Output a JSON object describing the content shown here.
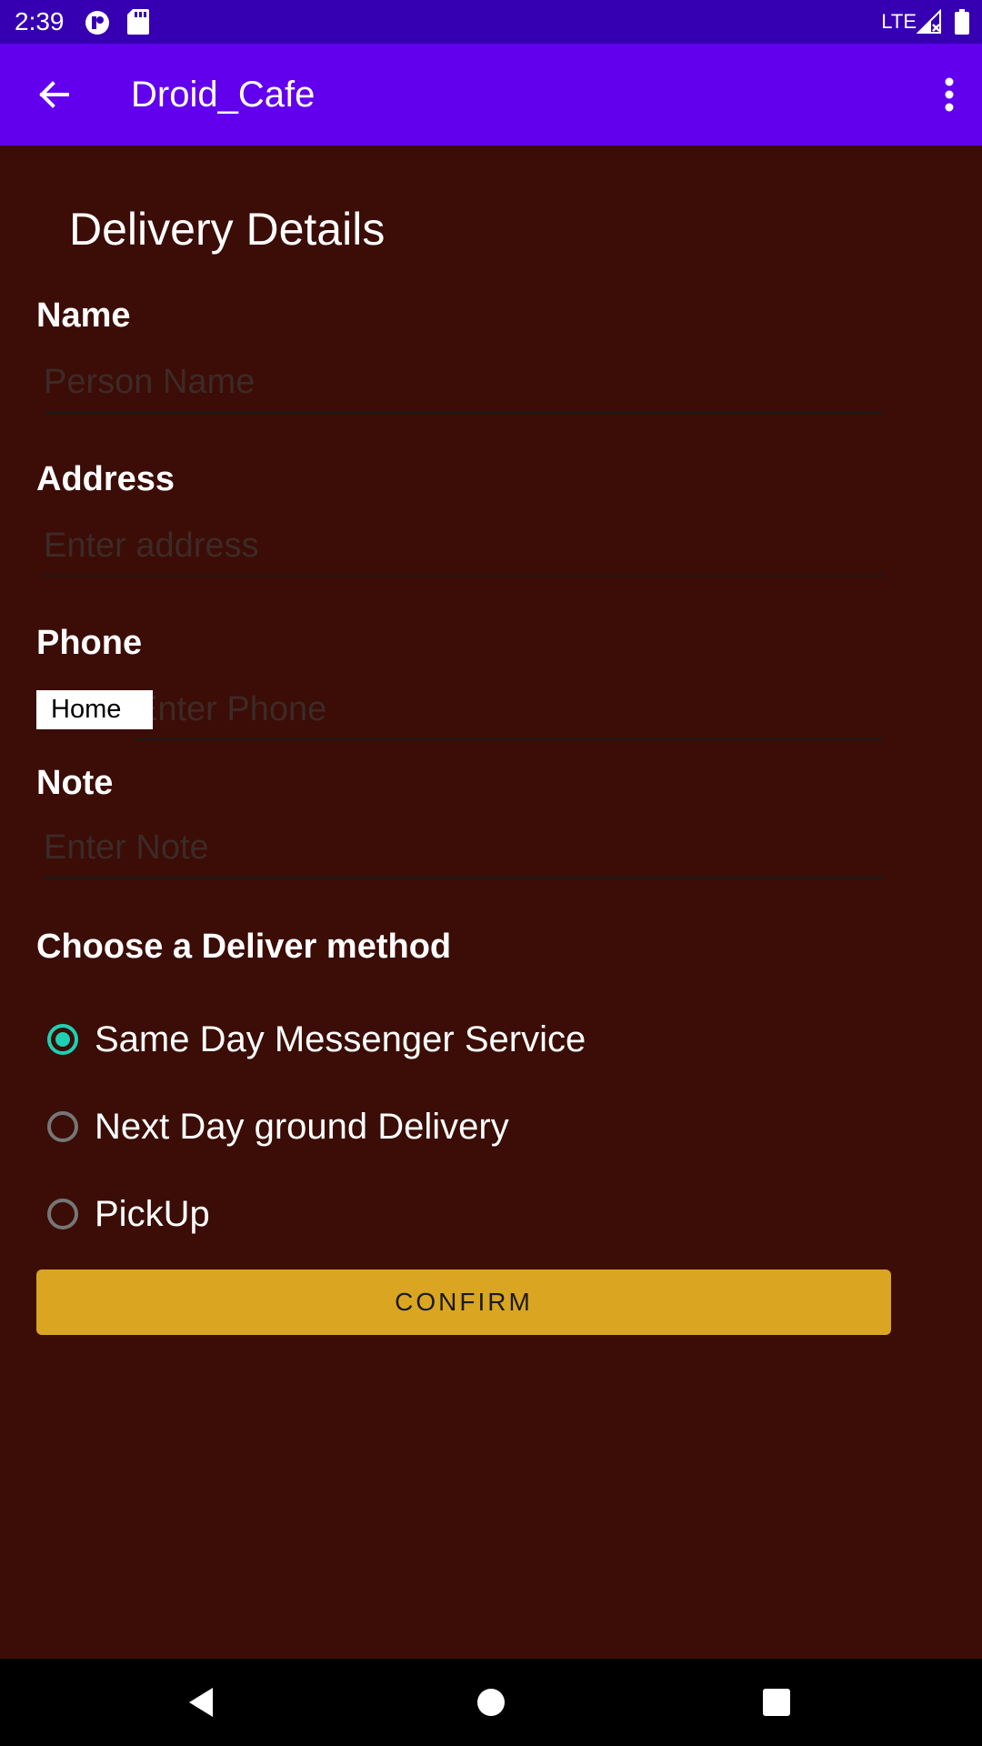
{
  "status_bar": {
    "time": "2:39",
    "network": "LTE",
    "icons": [
      "data-saver-icon",
      "sd-card-icon",
      "signal-icon",
      "battery-icon"
    ]
  },
  "app_bar": {
    "title": "Droid_Cafe",
    "back_icon": "arrow-back-icon",
    "menu_icon": "more-vert-icon"
  },
  "form": {
    "heading": "Delivery Details",
    "name": {
      "label": "Name",
      "placeholder": "Person Name",
      "value": ""
    },
    "address": {
      "label": "Address",
      "placeholder": "Enter address",
      "value": ""
    },
    "phone": {
      "label": "Phone",
      "placeholder": "Enter Phone",
      "value": "",
      "type": "Home"
    },
    "note": {
      "label": "Note",
      "placeholder": "Enter Note",
      "value": ""
    },
    "delivery": {
      "label": "Choose a Deliver method",
      "options": [
        {
          "label": "Same Day Messenger Service",
          "checked": true
        },
        {
          "label": "Next Day ground Delivery",
          "checked": false
        },
        {
          "label": "PickUp",
          "checked": false
        }
      ]
    },
    "confirm_label": "CONFIRM"
  },
  "colors": {
    "status_bar": "#3600b2",
    "app_bar": "#6200ee",
    "background": "#3b0d06",
    "accent": "#1ed0b3",
    "button": "#daa520"
  },
  "nav_bar": {
    "buttons": [
      "back-triangle-icon",
      "home-circle-icon",
      "recents-square-icon"
    ]
  }
}
